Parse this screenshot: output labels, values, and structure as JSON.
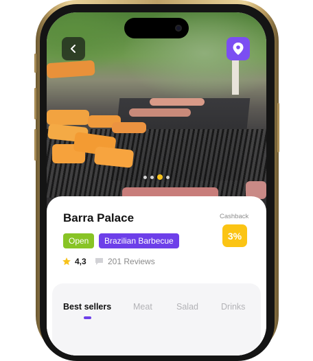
{
  "restaurant": {
    "name": "Barra Palace",
    "status": "Open",
    "category": "Brazilian Barbecue",
    "rating": "4,3",
    "reviews": "201 Reviews"
  },
  "cashback": {
    "label": "Cashback",
    "value": "3%"
  },
  "carousel": {
    "total_slides": 4,
    "active_slide": 3
  },
  "tabs": [
    {
      "label": "Best sellers",
      "active": true
    },
    {
      "label": "Meat",
      "active": false
    },
    {
      "label": "Salad",
      "active": false
    },
    {
      "label": "Drinks",
      "active": false
    }
  ],
  "icons": {
    "back": "chevron-left-icon",
    "location": "location-pin-icon",
    "rating": "star-icon",
    "reviews": "chat-bubble-icon"
  },
  "colors": {
    "accent": "#6d3fe9",
    "location_button": "#7b4ef2",
    "open_badge": "#88c425",
    "cashback_badge": "#fbc414",
    "star": "#f7c21b",
    "active_dot": "#f7c21b"
  }
}
